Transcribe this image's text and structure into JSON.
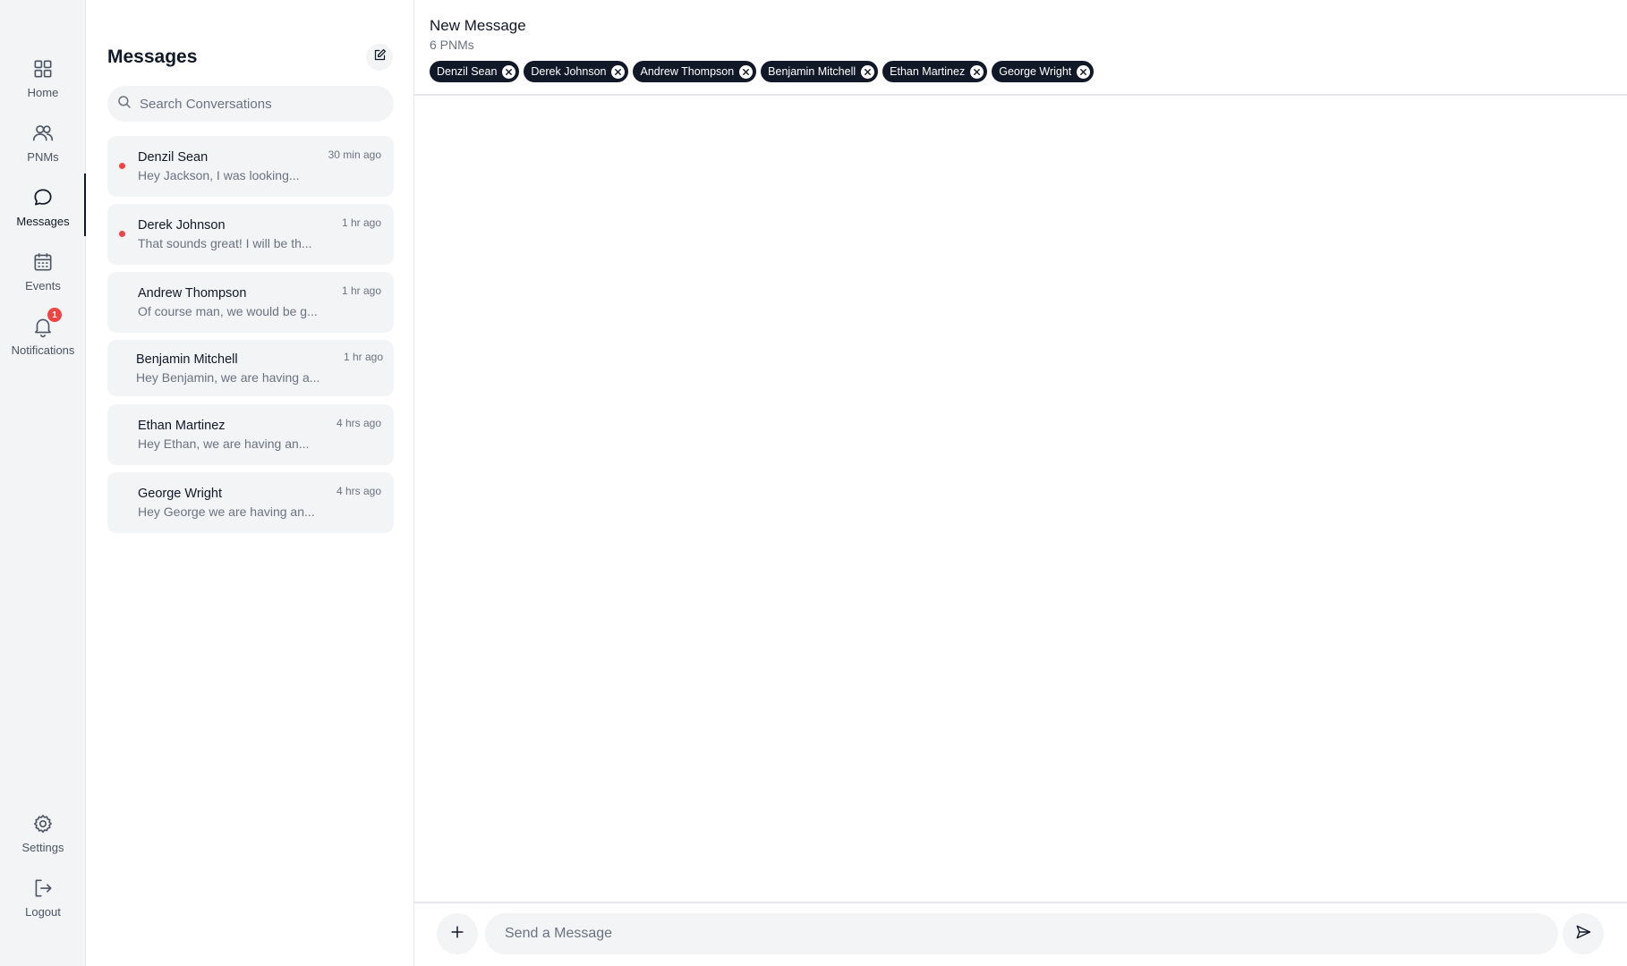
{
  "nav": {
    "items": [
      {
        "label": "Home",
        "icon": "grid-icon"
      },
      {
        "label": "PNMs",
        "icon": "users-icon"
      },
      {
        "label": "Messages",
        "icon": "chat-bubble-icon",
        "active": true
      },
      {
        "label": "Events",
        "icon": "calendar-icon"
      },
      {
        "label": "Notifications",
        "icon": "bell-icon",
        "badge": "1"
      }
    ],
    "bottom": [
      {
        "label": "Settings",
        "icon": "gear-icon"
      },
      {
        "label": "Logout",
        "icon": "logout-icon"
      }
    ]
  },
  "list": {
    "title": "Messages",
    "search_placeholder": "Search Conversations",
    "conversations": [
      {
        "name": "Denzil Sean",
        "preview": "Hey Jackson, I was looking...",
        "time": "30 min ago",
        "unread": true
      },
      {
        "name": "Derek Johnson",
        "preview": "That sounds great! I will be th...",
        "time": "1 hr ago",
        "unread": true
      },
      {
        "name": "Andrew Thompson",
        "preview": "Of course man, we would be g...",
        "time": "1 hr ago",
        "unread": false
      },
      {
        "name": "Benjamin Mitchell",
        "preview": "Hey Benjamin, we are having a...",
        "time": "1 hr ago",
        "unread": false
      },
      {
        "name": "Ethan Martinez",
        "preview": "Hey Ethan, we are having an...",
        "time": "4 hrs ago",
        "unread": false
      },
      {
        "name": "George Wright",
        "preview": "Hey George we are having an...",
        "time": "4 hrs ago",
        "unread": false
      }
    ]
  },
  "main": {
    "title": "New Message",
    "subtitle": "6 PNMs",
    "recipients": [
      "Denzil Sean",
      "Derek Johnson",
      "Andrew Thompson",
      "Benjamin Mitchell",
      "Ethan Martinez",
      "George Wright"
    ],
    "input_placeholder": "Send a Message"
  },
  "colors": {
    "rail_bg": "#f3f4f6",
    "dark": "#111827",
    "unread_dot": "#ef4444",
    "badge": "#ef4444",
    "muted_text": "#6b7280"
  }
}
